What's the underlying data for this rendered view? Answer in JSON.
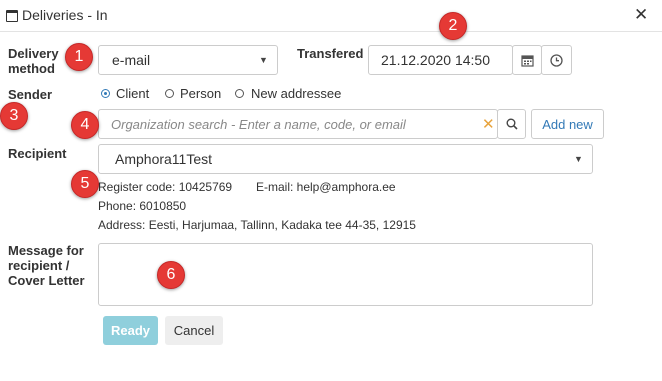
{
  "window": {
    "title": "Deliveries - In"
  },
  "form": {
    "delivery_method_label": "Delivery method",
    "delivery_method_value": "e-mail",
    "transferred_label": "Transfered",
    "transferred_value": "21.12.2020 14:50",
    "sender_label": "Sender",
    "sender_options": [
      "Client",
      "Person",
      "New addressee"
    ],
    "sender_selected": "Client",
    "search_placeholder": "Organization search - Enter a name, code, or email",
    "add_new_label": "Add new",
    "recipient_label": "Recipient",
    "recipient_value": "Amphora11Test",
    "register_code": "Register code: 10425769",
    "email": "E-mail: help@amphora.ee",
    "phone": "Phone: 6010850",
    "address": "Address: Eesti, Harjumaa, Tallinn, Kadaka tee 44-35, 12915",
    "message_label": "Message for recipient / Cover Letter",
    "message_value": ""
  },
  "buttons": {
    "ready": "Ready",
    "cancel": "Cancel"
  },
  "annotations": [
    "1",
    "2",
    "3",
    "4",
    "5",
    "6"
  ],
  "icons": [
    "window-icon",
    "close-icon",
    "calendar-icon",
    "clock-icon",
    "clear-icon",
    "search-icon",
    "chevron-down-icon"
  ]
}
